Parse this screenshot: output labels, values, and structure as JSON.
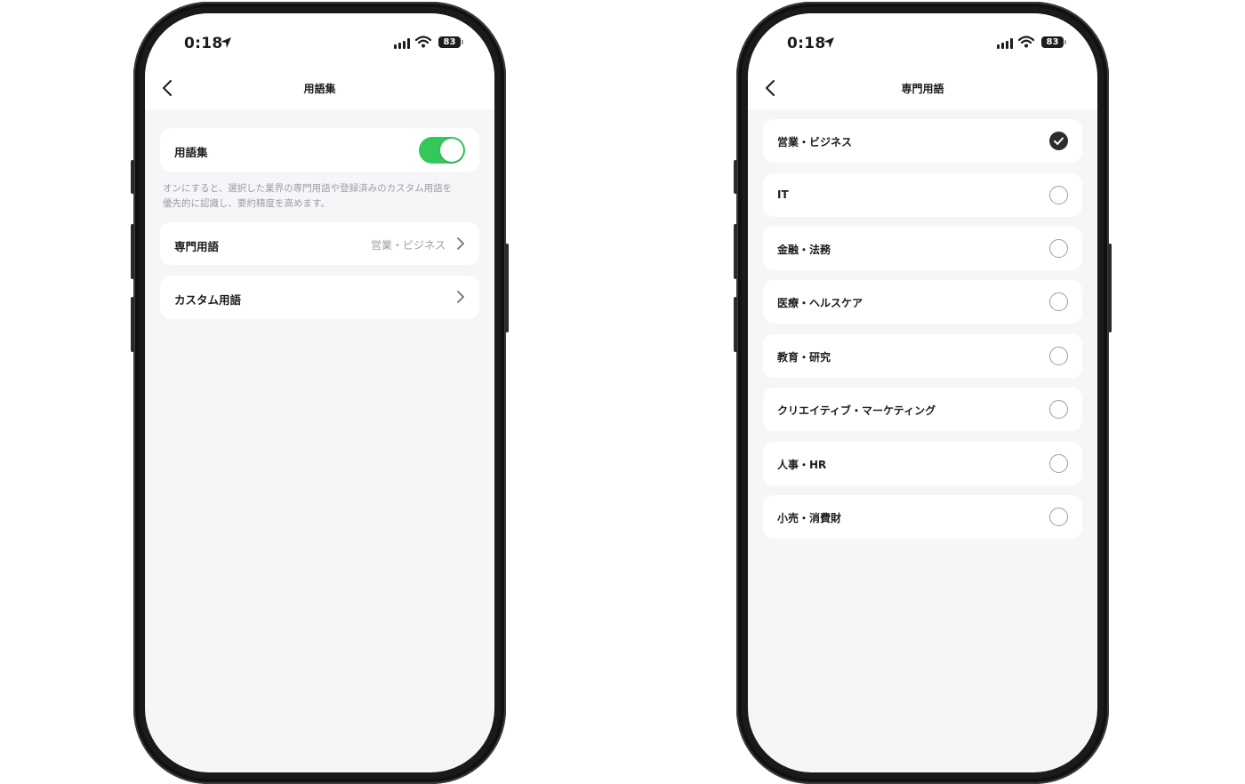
{
  "status": {
    "time": "0:18",
    "battery": "83"
  },
  "glossary_screen": {
    "title": "用語集",
    "toggle_label": "用語集",
    "toggle_on": true,
    "hint_line1": "オンにすると、選択した業界の専門用語や登録済みのカスタム用語を",
    "hint_line2": "優先的に認識し、要約精度を高めます。",
    "specialized_label": "専門用語",
    "specialized_value": "営業・ビジネス",
    "custom_label": "カスタム用語"
  },
  "terms_screen": {
    "title": "専門用語",
    "options": [
      {
        "label": "営業・ビジネス",
        "selected": true
      },
      {
        "label": "IT",
        "selected": false
      },
      {
        "label": "金融・法務",
        "selected": false
      },
      {
        "label": "医療・ヘルスケア",
        "selected": false
      },
      {
        "label": "教育・研究",
        "selected": false
      },
      {
        "label": "クリエイティブ・マーケティング",
        "selected": false
      },
      {
        "label": "人事・HR",
        "selected": false
      },
      {
        "label": "小売・消費財",
        "selected": false
      }
    ]
  }
}
